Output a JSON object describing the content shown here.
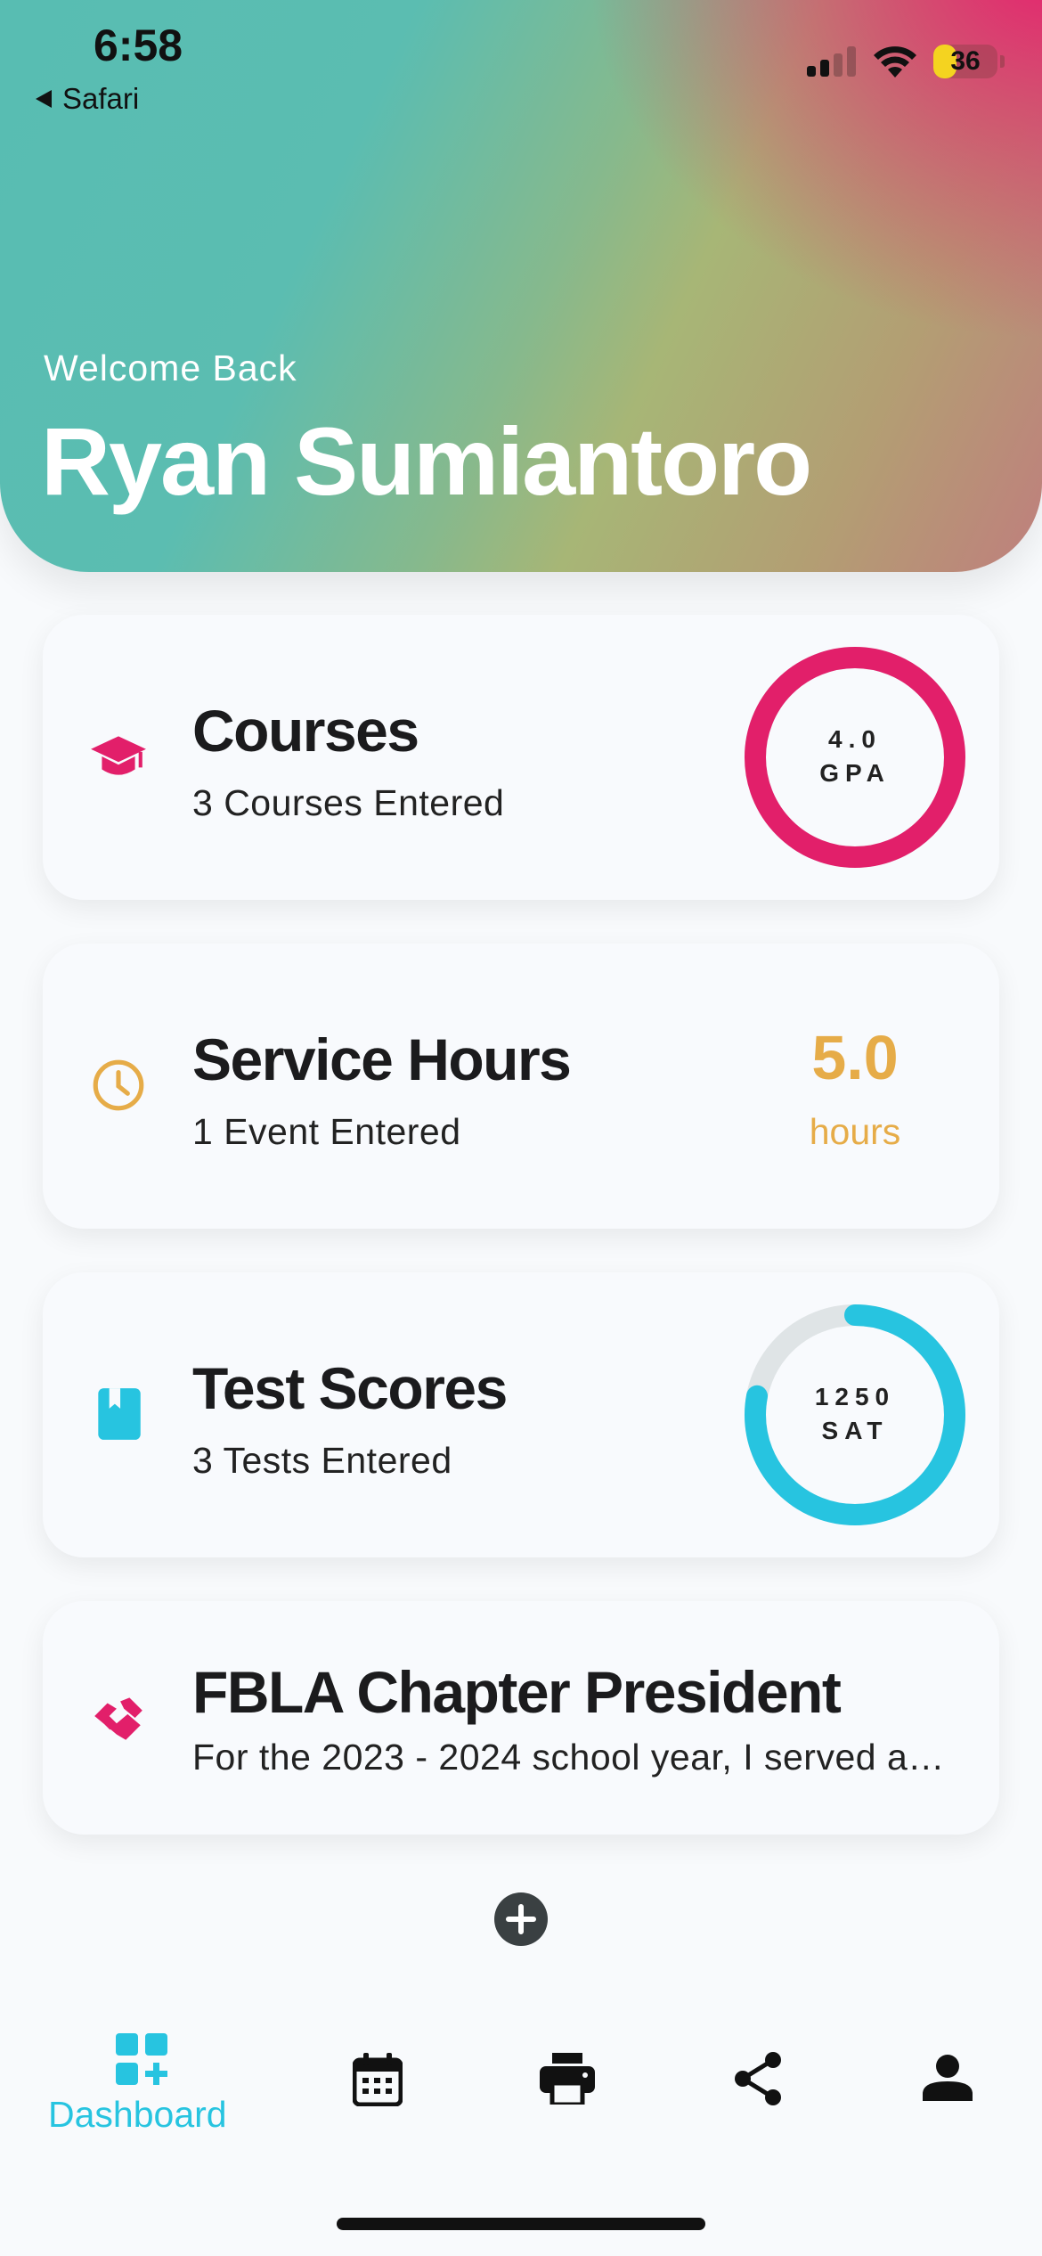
{
  "status_bar": {
    "time": "6:58",
    "back_app": "Safari",
    "battery": "36",
    "battery_level": 0.36
  },
  "header": {
    "welcome": "Welcome Back",
    "user_name": "Ryan Sumiantoro"
  },
  "cards": {
    "courses": {
      "title": "Courses",
      "subtitle": "3 Courses Entered",
      "ring_value": "4.0",
      "ring_unit": "GPA",
      "ring_progress": 1.0,
      "icon": "graduation-cap-icon",
      "color": "#e21f6a"
    },
    "service": {
      "title": "Service Hours",
      "subtitle": "1 Event Entered",
      "value": "5.0",
      "unit": "hours",
      "icon": "clock-icon",
      "color": "#e6ac48"
    },
    "tests": {
      "title": "Test Scores",
      "subtitle": "3 Tests Entered",
      "ring_value": "1250",
      "ring_unit": "SAT",
      "ring_progress": 0.78,
      "icon": "book-icon",
      "color": "#27c4e0"
    },
    "achievement": {
      "title": "FBLA Chapter President",
      "subtitle": "For the 2023 - 2024 school year, I served a…",
      "icon": "handshake-icon",
      "color": "#e21f6a"
    }
  },
  "tabbar": {
    "active_label": "Dashboard",
    "items": [
      "dashboard-icon",
      "calendar-icon",
      "printer-icon",
      "share-icon",
      "profile-icon"
    ],
    "accent": "#27c4e0"
  }
}
